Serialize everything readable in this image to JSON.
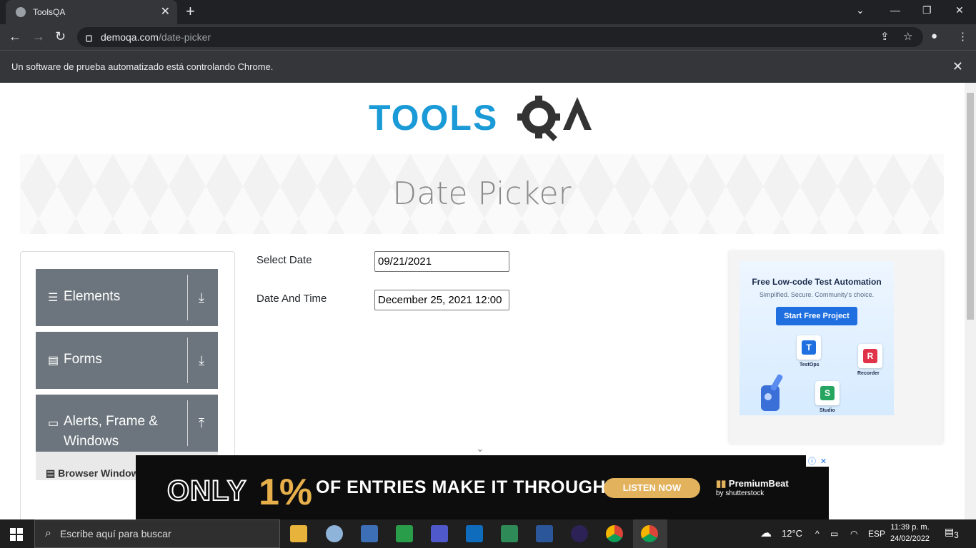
{
  "browser": {
    "tab_title": "ToolsQA",
    "url_host": "demoqa.com",
    "url_path": "/date-picker",
    "infobar_text": "Un software de prueba automatizado está controlando Chrome."
  },
  "page": {
    "logo_text": "TOOLSQA",
    "title": "Date Picker",
    "sidebar": {
      "groups": [
        {
          "label": "Elements",
          "icon": "hamburger-icon",
          "expanded": false
        },
        {
          "label": "Forms",
          "icon": "document-icon",
          "expanded": false
        },
        {
          "label": "Alerts, Frame & Windows",
          "icon": "window-icon",
          "expanded": true
        }
      ],
      "sub_item": "Browser Windows"
    },
    "form": {
      "select_date_label": "Select Date",
      "select_date_value": "09/21/2021",
      "date_time_label": "Date And Time",
      "date_time_value": "December 25, 2021 12:00"
    }
  },
  "side_ad": {
    "title": "Free Low-code Test Automation",
    "subtitle": "Simplified. Secure. Community's choice.",
    "cta": "Start Free Project",
    "products": [
      "TestOps",
      "Recorder",
      "Studio"
    ],
    "product_letters": [
      "T",
      "R",
      "S"
    ]
  },
  "bottom_ad": {
    "only": "ONLY",
    "percent": "1%",
    "rest": "OF ENTRIES MAKE IT THROUGH",
    "cta": "LISTEN NOW",
    "brand": "PremiumBeat",
    "brand_sub": "by shutterstock"
  },
  "taskbar": {
    "search_placeholder": "Escribe aquí para buscar",
    "weather": "12°C",
    "language": "ESP",
    "time": "11:39 p. m.",
    "date": "24/02/2022",
    "notification_count": "3"
  },
  "colors": {
    "sidebar_group": "#6c757d",
    "logo_blue": "#1a9ad6",
    "logo_dark": "#333333",
    "ad_cta": "#1f6fe0",
    "listen_cta": "#e3b25d",
    "percent_gold": "#e8b04b"
  }
}
